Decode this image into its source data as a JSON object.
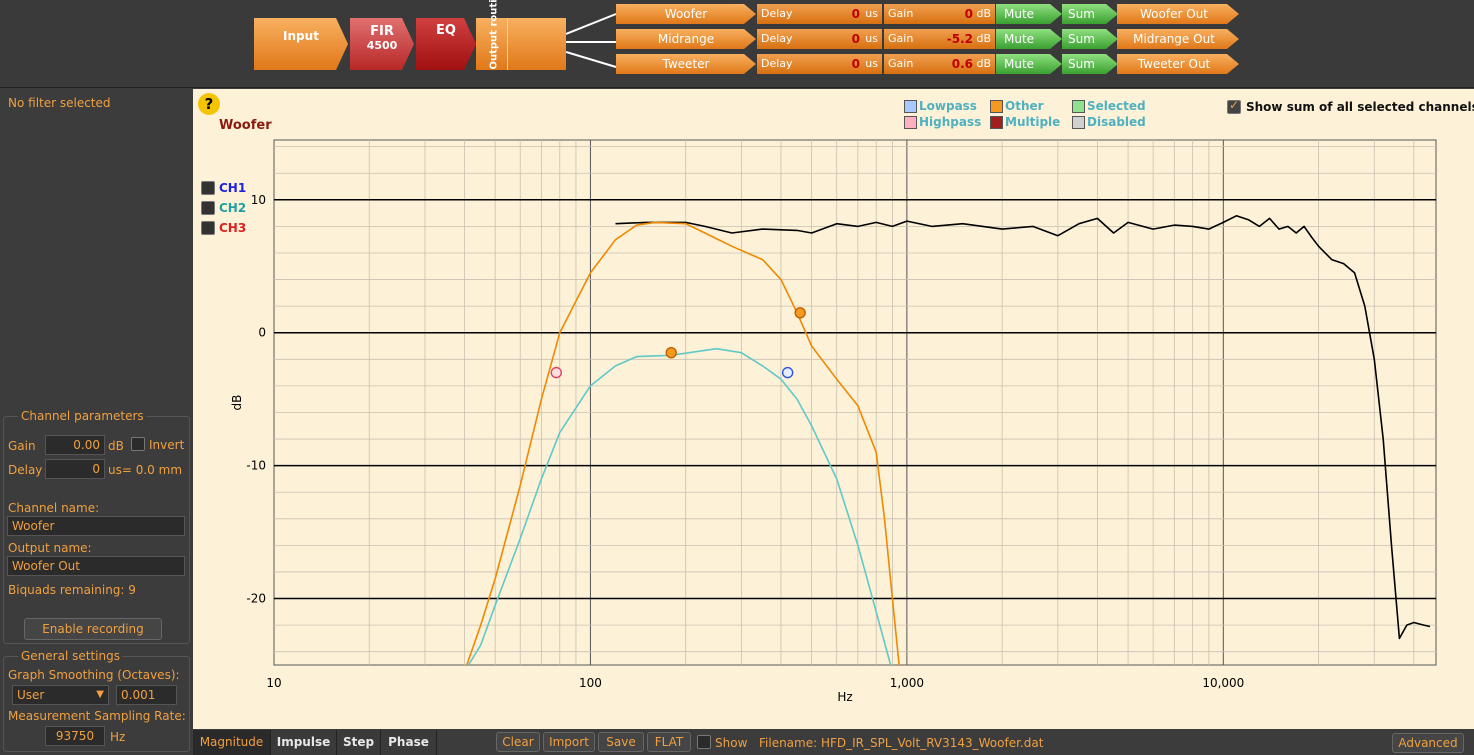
{
  "signal_chain": {
    "input_label": "Input",
    "fir_label": "FIR",
    "fir_taps": "4500",
    "eq_label": "EQ",
    "output_routing_label": "Output routing"
  },
  "channels": [
    {
      "name": "Woofer",
      "delay_label": "Delay",
      "delay_value": "0",
      "delay_unit": "us",
      "gain_label": "Gain",
      "gain_value": "0",
      "gain_unit": "dB",
      "mute_label": "Mute",
      "sum_label": "Sum",
      "output_name": "Woofer Out"
    },
    {
      "name": "Midrange",
      "delay_label": "Delay",
      "delay_value": "0",
      "delay_unit": "us",
      "gain_label": "Gain",
      "gain_value": "-5.2",
      "gain_unit": "dB",
      "mute_label": "Mute",
      "sum_label": "Sum",
      "output_name": "Midrange Out"
    },
    {
      "name": "Tweeter",
      "delay_label": "Delay",
      "delay_value": "0",
      "delay_unit": "us",
      "gain_label": "Gain",
      "gain_value": "0.6",
      "gain_unit": "dB",
      "mute_label": "Mute",
      "sum_label": "Sum",
      "output_name": "Tweeter Out"
    }
  ],
  "left_panel": {
    "filter_status": "No filter selected",
    "channel_params_title": "Channel parameters",
    "gain_label": "Gain",
    "gain_value": "0.00",
    "gain_unit": "dB",
    "invert_label": "Invert",
    "delay_label": "Delay",
    "delay_value": "0",
    "delay_unit": "us= 0.0 mm",
    "channel_name_label": "Channel name:",
    "channel_name_value": "Woofer",
    "output_name_label": "Output name:",
    "output_name_value": "Woofer Out",
    "biquads_remaining": "Biquads remaining: 9",
    "enable_recording_label": "Enable recording",
    "general_settings_title": "General settings",
    "smoothing_label": "Graph Smoothing (Octaves):",
    "smoothing_mode": "User",
    "smoothing_value": "0.001",
    "sampling_rate_label": "Measurement Sampling Rate:",
    "sampling_rate_value": "93750",
    "sampling_rate_unit": "Hz"
  },
  "plot_panel": {
    "help_icon_text": "?",
    "channel_title": "Woofer",
    "show_sum_label": "Show sum of all selected channels",
    "legend": [
      {
        "label": "Lowpass",
        "color": "#a8c8ff"
      },
      {
        "label": "Highpass",
        "color": "#ffb0c0"
      },
      {
        "label": "Other",
        "color": "#f59a20"
      },
      {
        "label": "Multiple",
        "color": "#a02020"
      },
      {
        "label": "Selected",
        "color": "#90e090"
      },
      {
        "label": "Disabled",
        "color": "#d0d0d0"
      }
    ],
    "measurement_channels": [
      {
        "label": "CH1",
        "color": "#2020e0"
      },
      {
        "label": "CH2",
        "color": "#20a0a0"
      },
      {
        "label": "CH3",
        "color": "#e02020"
      }
    ]
  },
  "chart_data": {
    "type": "line",
    "xlabel": "Hz",
    "ylabel": "dB",
    "x_scale": "log",
    "xlim": [
      10,
      47000
    ],
    "ylim": [
      -25,
      14.5
    ],
    "x_ticks": [
      10,
      100,
      1000,
      10000
    ],
    "x_tick_labels": [
      "10",
      "100",
      "1,000",
      "10,000"
    ],
    "y_ticks": [
      10,
      0,
      -10,
      -20
    ],
    "y_tick_labels": [
      "10",
      "0",
      "-10",
      "-20"
    ],
    "grid": true,
    "series": [
      {
        "color": "#000000",
        "points": [
          [
            120,
            8.2
          ],
          [
            150,
            8.3
          ],
          [
            200,
            8.3
          ],
          [
            230,
            8.0
          ],
          [
            280,
            7.5
          ],
          [
            350,
            7.8
          ],
          [
            450,
            7.7
          ],
          [
            500,
            7.5
          ],
          [
            600,
            8.2
          ],
          [
            700,
            8.0
          ],
          [
            800,
            8.3
          ],
          [
            900,
            8.0
          ],
          [
            1000,
            8.4
          ],
          [
            1200,
            8.0
          ],
          [
            1500,
            8.2
          ],
          [
            2000,
            7.8
          ],
          [
            2500,
            8.0
          ],
          [
            3000,
            7.3
          ],
          [
            3500,
            8.2
          ],
          [
            4000,
            8.6
          ],
          [
            4500,
            7.5
          ],
          [
            5000,
            8.3
          ],
          [
            6000,
            7.8
          ],
          [
            7000,
            8.1
          ],
          [
            8000,
            8.0
          ],
          [
            9000,
            7.8
          ],
          [
            10000,
            8.3
          ],
          [
            11000,
            8.8
          ],
          [
            12000,
            8.5
          ],
          [
            13000,
            8.0
          ],
          [
            14000,
            8.6
          ],
          [
            15000,
            7.8
          ],
          [
            16000,
            8.0
          ],
          [
            17000,
            7.5
          ],
          [
            18000,
            8.0
          ],
          [
            19000,
            7.2
          ],
          [
            20000,
            6.5
          ],
          [
            22000,
            5.5
          ],
          [
            24000,
            5.2
          ],
          [
            26000,
            4.5
          ],
          [
            28000,
            2.0
          ],
          [
            30000,
            -2.0
          ],
          [
            32000,
            -8.0
          ],
          [
            34000,
            -16.0
          ],
          [
            36000,
            -23.0
          ],
          [
            38000,
            -22.0
          ],
          [
            40000,
            -21.8
          ],
          [
            43000,
            -22.0
          ],
          [
            45000,
            -22.1
          ]
        ]
      },
      {
        "color": "#f08800",
        "points": [
          [
            40,
            -25.5
          ],
          [
            45,
            -22
          ],
          [
            50,
            -18.5
          ],
          [
            60,
            -11.5
          ],
          [
            70,
            -5
          ],
          [
            80,
            0
          ],
          [
            100,
            4.5
          ],
          [
            120,
            7
          ],
          [
            140,
            8.1
          ],
          [
            160,
            8.3
          ],
          [
            200,
            8.2
          ],
          [
            230,
            7.5
          ],
          [
            280,
            6.5
          ],
          [
            350,
            5.5
          ],
          [
            400,
            4.0
          ],
          [
            450,
            1.5
          ],
          [
            500,
            -1.0
          ],
          [
            600,
            -3.5
          ],
          [
            700,
            -5.5
          ],
          [
            800,
            -9.0
          ],
          [
            850,
            -14.0
          ],
          [
            900,
            -20.0
          ],
          [
            950,
            -25.5
          ]
        ]
      },
      {
        "color": "#60c8c8",
        "points": [
          [
            40,
            -25.5
          ],
          [
            45,
            -23.5
          ],
          [
            50,
            -20.5
          ],
          [
            60,
            -15.5
          ],
          [
            70,
            -11
          ],
          [
            80,
            -7.5
          ],
          [
            100,
            -4.0
          ],
          [
            120,
            -2.5
          ],
          [
            140,
            -1.8
          ],
          [
            180,
            -1.7
          ],
          [
            250,
            -1.2
          ],
          [
            300,
            -1.5
          ],
          [
            350,
            -2.5
          ],
          [
            400,
            -3.5
          ],
          [
            450,
            -5.0
          ],
          [
            500,
            -7.0
          ],
          [
            600,
            -11.0
          ],
          [
            700,
            -16.0
          ],
          [
            800,
            -21.0
          ],
          [
            900,
            -25.5
          ]
        ]
      }
    ],
    "markers": [
      {
        "x": 78,
        "y": -3.0,
        "fill": "#fde0e0",
        "stroke": "#e04060"
      },
      {
        "x": 180,
        "y": -1.5,
        "fill": "#f59a20",
        "stroke": "#c06000"
      },
      {
        "x": 460,
        "y": 1.5,
        "fill": "#f59a20",
        "stroke": "#c06000"
      },
      {
        "x": 420,
        "y": -3.0,
        "fill": "#e8ecff",
        "stroke": "#3050e0"
      }
    ]
  },
  "bottom_bar": {
    "tabs": [
      "Magnitude",
      "Impulse",
      "Step",
      "Phase"
    ],
    "active_tab": "Magnitude",
    "clear_label": "Clear",
    "import_label": "Import",
    "save_label": "Save",
    "flat_label": "FLAT",
    "show_label": "Show",
    "filename_text": "Filename: HFD_IR_SPL_Volt_RV3143_Woofer.dat",
    "advanced_label": "Advanced"
  }
}
